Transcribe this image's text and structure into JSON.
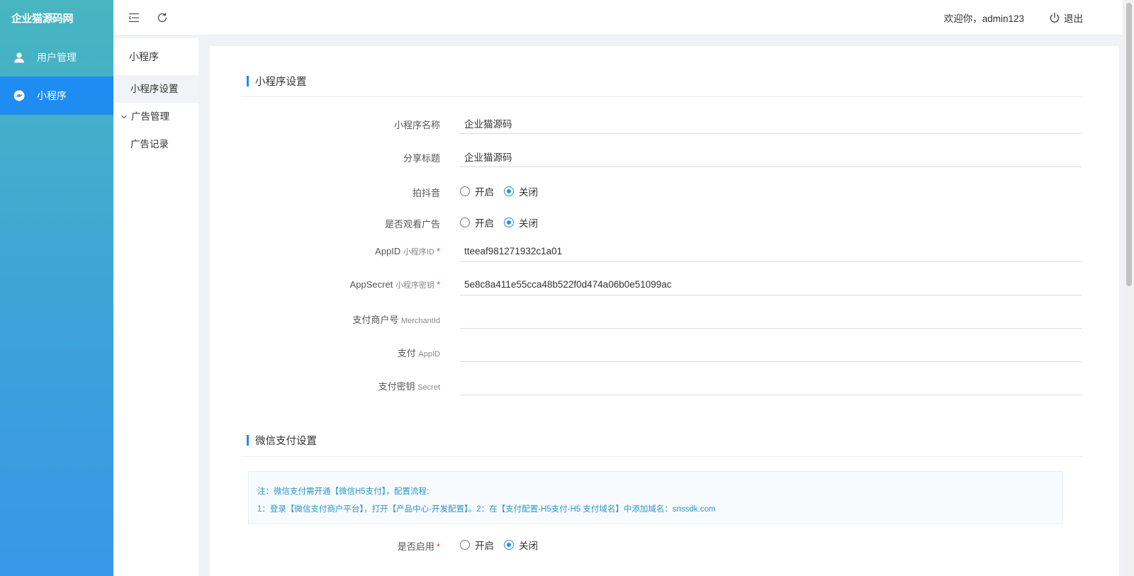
{
  "app": {
    "brand": "企业猫源码网",
    "nav": [
      {
        "label": "用户管理",
        "icon": "user-icon"
      },
      {
        "label": "小程序",
        "icon": "miniprogram-icon"
      }
    ]
  },
  "submenu": {
    "title": "小程序",
    "items": [
      "小程序设置"
    ],
    "group_label": "广告管理",
    "group_items": [
      "广告记录"
    ]
  },
  "header": {
    "welcome": "欢迎你，admin123",
    "logout": "退出"
  },
  "section1": {
    "title": "小程序设置",
    "name_label": "小程序名称",
    "name_value": "企业猫源码",
    "share_label": "分享标题",
    "share_value": "企业猫源码",
    "douyin_label": "拍抖音",
    "ads_label": "是否观看广告",
    "appid_label": "AppID",
    "appid_small": "小程序ID",
    "appid_value": "tteeaf981271932c1a01",
    "secret_label": "AppSecret",
    "secret_small": "小程序密钥",
    "secret_value": "5e8c8a411e55cca48b522f0d474a06b0e51099ac",
    "merchant_label": "支付商户号",
    "merchant_small": "MerchantId",
    "payappid_label": "支付",
    "payappid_small": "AppID",
    "paysecret_label": "支付密钥",
    "paysecret_small": "Secret"
  },
  "radio": {
    "on": "开启",
    "off": "关闭",
    "douyin_selected": "关闭",
    "ads_selected": "关闭",
    "enable_selected": "关闭"
  },
  "required_mark": "*",
  "section2": {
    "title": "微信支付设置",
    "notice_line1": "注：微信支付需开通【微信H5支付】，配置流程:",
    "notice_line2": "1：登录【微信支付商户平台】，打开【产品中心-开发配置】。2：在【支付配置-H5支付-H5 支付域名】中添加域名：snssdk.com",
    "enable_label": "是否启用"
  },
  "colors": {
    "accent": "#1e8cf0",
    "section_bar": "#1e8ddb",
    "notice_text": "#2d96c8",
    "required": "#e74c3c"
  }
}
